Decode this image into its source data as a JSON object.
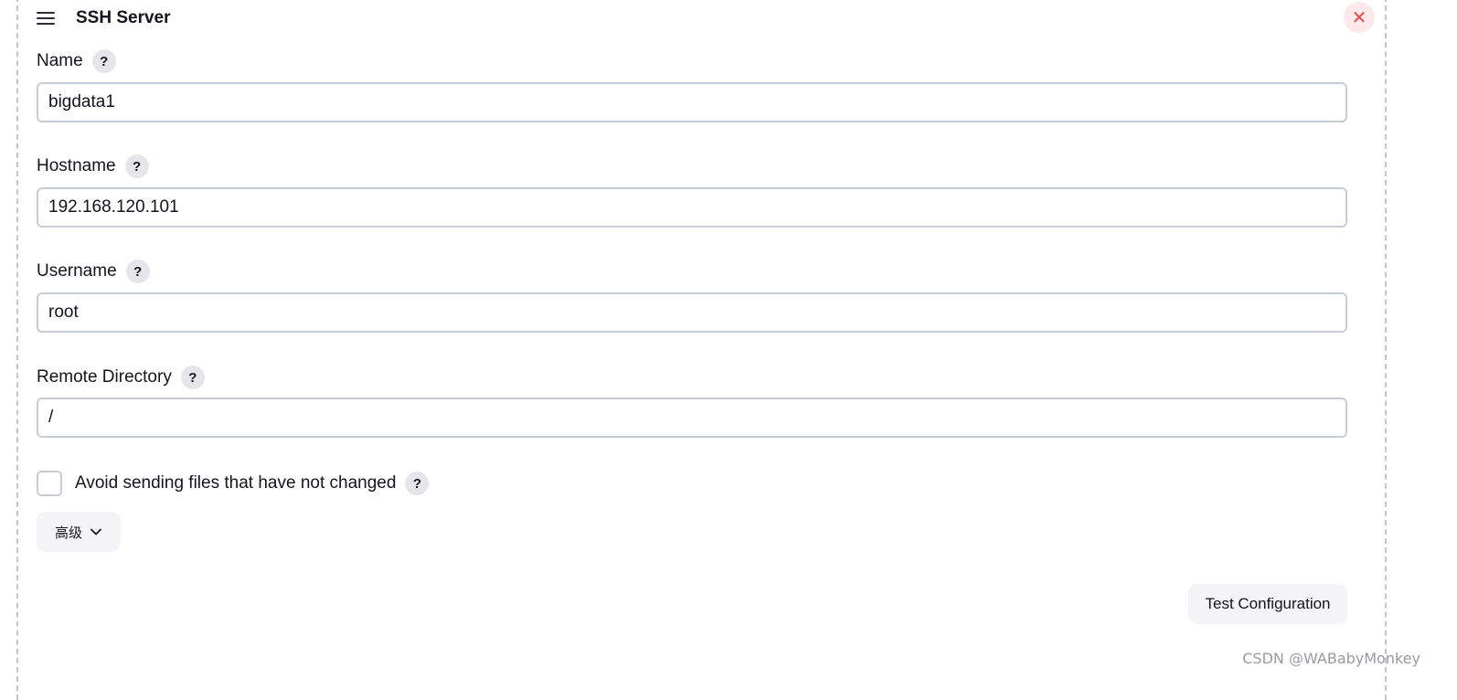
{
  "header": {
    "title": "SSH Server",
    "menu_icon": "hamburger-menu-icon",
    "close_icon": "close-icon",
    "close_glyph": "✕"
  },
  "fields": {
    "name": {
      "label": "Name",
      "value": "bigdata1"
    },
    "hostname": {
      "label": "Hostname",
      "value": "192.168.120.101"
    },
    "username": {
      "label": "Username",
      "value": "root"
    },
    "remote_directory": {
      "label": "Remote Directory",
      "value": "/"
    }
  },
  "help_glyph": "?",
  "checkbox": {
    "label": "Avoid sending files that have not changed",
    "checked": false
  },
  "advanced_button": {
    "label": "高级",
    "icon": "chevron-down-icon"
  },
  "test_button": {
    "label": "Test Configuration"
  },
  "watermark": "CSDN @WABabyMonkey",
  "colors": {
    "close_bg": "#fde8ea",
    "close_fg": "#e5484d",
    "button_bg": "#f4f4f6",
    "input_border": "#c8ccd4",
    "help_bg": "#e6e6ea"
  }
}
